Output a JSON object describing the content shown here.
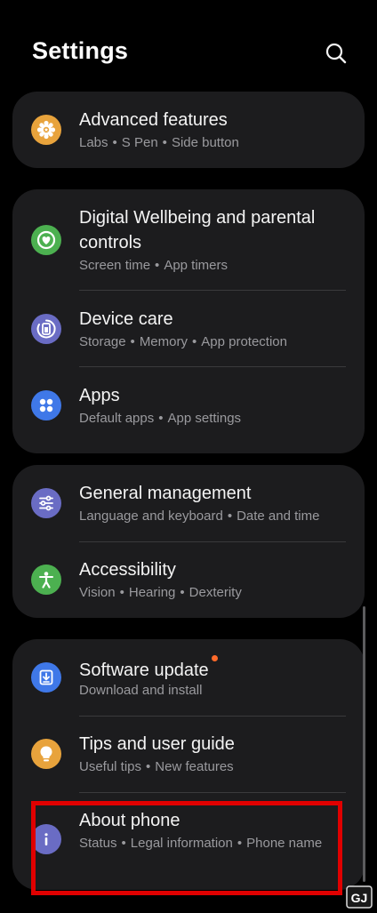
{
  "header": {
    "title": "Settings"
  },
  "colors": {
    "background": "#000000",
    "card": "#1c1c1e",
    "divider": "#3a3a3c",
    "subtitle": "#9a9a9e",
    "notification_dot": "#ff6a2a",
    "highlight_box": "#e00000"
  },
  "groups": [
    {
      "items": [
        {
          "title": "Advanced features",
          "subtitle": [
            "Labs",
            "S Pen",
            "Side button"
          ],
          "icon": "gear-star-icon",
          "icon_color": "#e8a33c"
        }
      ]
    },
    {
      "items": [
        {
          "title": "Digital Wellbeing and parental controls",
          "subtitle": [
            "Screen time",
            "App timers"
          ],
          "icon": "heart-ring-icon",
          "icon_color": "#4cb050"
        },
        {
          "title": "Device care",
          "subtitle": [
            "Storage",
            "Memory",
            "App protection"
          ],
          "icon": "device-care-icon",
          "icon_color": "#6a6cc4"
        },
        {
          "title": "Apps",
          "subtitle": [
            "Default apps",
            "App settings"
          ],
          "icon": "apps-grid-icon",
          "icon_color": "#3f78e8"
        }
      ]
    },
    {
      "items": [
        {
          "title": "General management",
          "subtitle": [
            "Language and keyboard",
            "Date and time"
          ],
          "icon": "sliders-icon",
          "icon_color": "#6a6cc4"
        },
        {
          "title": "Accessibility",
          "subtitle": [
            "Vision",
            "Hearing",
            "Dexterity"
          ],
          "icon": "accessibility-person-icon",
          "icon_color": "#4cb050"
        }
      ]
    },
    {
      "items": [
        {
          "title": "Software update",
          "subtitle": [
            "Download and install"
          ],
          "icon": "download-update-icon",
          "icon_color": "#3f78e8",
          "has_notification_dot": true
        },
        {
          "title": "Tips and user guide",
          "subtitle": [
            "Useful tips",
            "New features"
          ],
          "icon": "lightbulb-icon",
          "icon_color": "#e8a33c"
        },
        {
          "title": "About phone",
          "subtitle": [
            "Status",
            "Legal information",
            "Phone name"
          ],
          "icon": "info-icon",
          "icon_color": "#6a6cc4",
          "highlighted": true
        }
      ]
    }
  ],
  "watermark": {
    "text": "GJ",
    "icon": "gadgets-to-use-logo-icon"
  }
}
